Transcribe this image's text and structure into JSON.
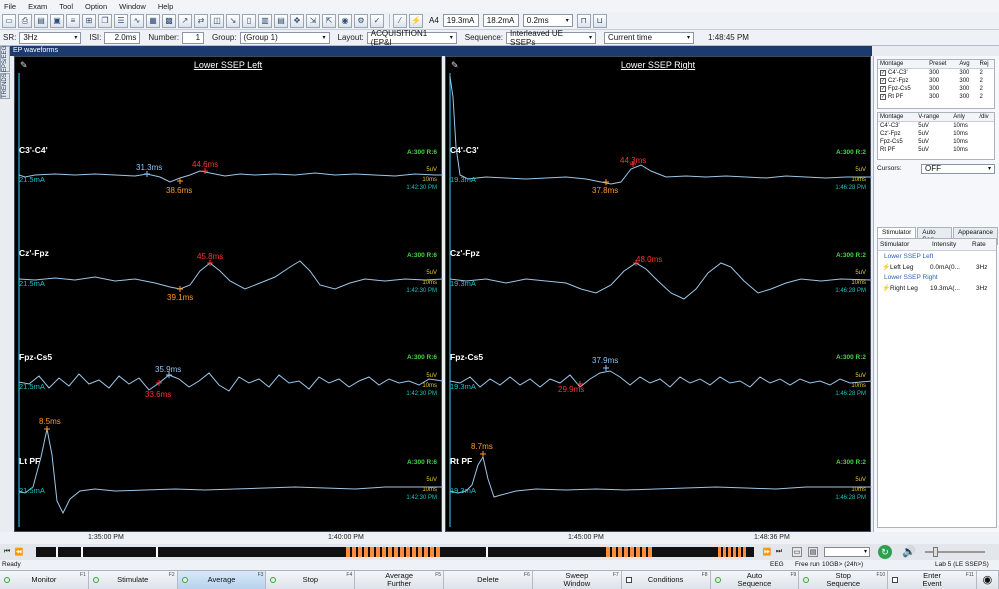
{
  "menu": [
    "File",
    "Exam",
    "Tool",
    "Option",
    "Window",
    "Help"
  ],
  "toolbar": {
    "paper_size": "A4",
    "intensity_1": "19.3mA",
    "intensity_2": "18.2mA",
    "duration": "0.2ms"
  },
  "settings": {
    "sr_label": "SR:",
    "sr_value": "3Hz",
    "isi_label": "ISI:",
    "isi_value": "2.0ms",
    "number_label": "Number:",
    "number_value": "1",
    "group_label": "Group:",
    "group_value": "(Group 1)",
    "layout_label": "Layout:",
    "layout_value": "ACQUISITION1 (EP&I",
    "sequence_label": "Sequence:",
    "sequence_value": "Interleaved UE SSEPs",
    "time_mode": "Current time",
    "clock": "1:48:45 PM"
  },
  "side_tabs": [
    "EPS/EEG",
    "TRENDS"
  ],
  "window_title": "EP waveforms",
  "left_panel": {
    "title": "Lower SSEP Left",
    "traces": [
      {
        "name": "C3'-C4'",
        "current": "21.5mA",
        "scale_a": "A:300 R:6",
        "uv": "5uV",
        "ms": "10ms",
        "time": "1:42:30 PM",
        "peaks": [
          {
            "label": "31.3ms",
            "color": "blue"
          },
          {
            "label": "44.6ms",
            "color": "red"
          },
          {
            "label": "38.6ms",
            "color": "orange"
          }
        ]
      },
      {
        "name": "Cz'-Fpz",
        "current": "21.5mA",
        "scale_a": "A:300 R:6",
        "uv": "5uV",
        "ms": "10ms",
        "time": "1:42:30 PM",
        "peaks": [
          {
            "label": "45.8ms",
            "color": "red"
          },
          {
            "label": "39.1ms",
            "color": "orange"
          }
        ]
      },
      {
        "name": "Fpz-Cs5",
        "current": "21.5mA",
        "scale_a": "A:300 R:6",
        "uv": "5uV",
        "ms": "10ms",
        "time": "1:42:30 PM",
        "peaks": [
          {
            "label": "35.9ms",
            "color": "blue"
          },
          {
            "label": "33.6ms",
            "color": "red"
          }
        ]
      },
      {
        "name": "Lt PF",
        "current": "21.5mA",
        "scale_a": "A:300 R:6",
        "uv": "5uV",
        "ms": "10ms",
        "time": "1:42:30 PM",
        "peaks": [
          {
            "label": "8.5ms",
            "color": "orange"
          }
        ]
      }
    ]
  },
  "right_panel": {
    "title": "Lower SSEP Right",
    "traces": [
      {
        "name": "C4'-C3'",
        "current": "19.3mA",
        "scale_a": "A:300 R:2",
        "uv": "5uV",
        "ms": "10ms",
        "time": "1:46:28 PM",
        "peaks": [
          {
            "label": "44.3ms",
            "color": "red"
          },
          {
            "label": "37.8ms",
            "color": "orange"
          }
        ]
      },
      {
        "name": "Cz'-Fpz",
        "current": "19.3mA",
        "scale_a": "A:300 R:2",
        "uv": "5uV",
        "ms": "10ms",
        "time": "1:46:28 PM",
        "peaks": [
          {
            "label": "48.0ms",
            "color": "red"
          }
        ]
      },
      {
        "name": "Fpz-Cs5",
        "current": "19.3mA",
        "scale_a": "A:300 R:2",
        "uv": "5uV",
        "ms": "10ms",
        "time": "1:46:28 PM",
        "peaks": [
          {
            "label": "37.9ms",
            "color": "blue"
          },
          {
            "label": "29.9ms",
            "color": "red"
          }
        ]
      },
      {
        "name": "Rt PF",
        "current": "19.3mA",
        "scale_a": "A:300 R:2",
        "uv": "5uV",
        "ms": "10ms",
        "time": "1:46:28 PM",
        "peaks": [
          {
            "label": "8.7ms",
            "color": "orange"
          }
        ]
      }
    ]
  },
  "montage_table": {
    "headers": [
      "Montage",
      "Preset",
      "Avg",
      "Rej"
    ],
    "rows": [
      [
        "C4'-C3'",
        "300",
        "300",
        "2"
      ],
      [
        "Cz'-Fpz",
        "300",
        "300",
        "2"
      ],
      [
        "Fpz-Cs5",
        "300",
        "300",
        "2"
      ],
      [
        "Rt PF",
        "300",
        "300",
        "2"
      ]
    ]
  },
  "vrange_table": {
    "headers": [
      "Montage",
      "V-range",
      "Anly",
      "/div"
    ],
    "rows": [
      [
        "C4'-C3'",
        "5uV",
        "10ms",
        ""
      ],
      [
        "Cz'-Fpz",
        "5uV",
        "10ms",
        ""
      ],
      [
        "Fpz-Cs5",
        "5uV",
        "10ms",
        ""
      ],
      [
        "Rt PF",
        "5uV",
        "10ms",
        ""
      ]
    ]
  },
  "cursors": {
    "label": "Cursors:",
    "value": "OFF"
  },
  "tabs": [
    "Stimulator",
    "Auto Seq",
    "Appearance"
  ],
  "stimulator": {
    "headers": [
      "Stimulator",
      "Intensity",
      "Rate"
    ],
    "groups": [
      {
        "name": "Lower SSEP Left",
        "row": {
          "site": "Left Leg",
          "intensity": "0.0mA(0...",
          "rate": "3Hz"
        }
      },
      {
        "name": "Lower SSEP Right",
        "row": {
          "site": "Right Leg",
          "intensity": "19.3mA(...",
          "rate": "3Hz"
        }
      }
    ]
  },
  "timeline": {
    "labels": [
      "1:35:00 PM",
      "1:40:00 PM",
      "1:45:00 PM"
    ],
    "current": "1:48:36 PM"
  },
  "status": {
    "left": "Ready",
    "mode": "EEG",
    "run": "Free run",
    "disk": "10GB> (24h>)",
    "exam": "Lab 5 (LE SSEPS)"
  },
  "function_keys": [
    {
      "label": "Monitor",
      "key": "F1"
    },
    {
      "label": "Stimulate",
      "key": "F2"
    },
    {
      "label": "Average",
      "key": "F3"
    },
    {
      "label": "Stop",
      "key": "F4"
    },
    {
      "label": "Average Further",
      "key": "F5"
    },
    {
      "label": "Delete",
      "key": "F6"
    },
    {
      "label": "Sweep Window",
      "key": "F7"
    },
    {
      "label": "Conditions",
      "key": "F8"
    },
    {
      "label": "Auto Sequence",
      "key": "F9"
    },
    {
      "label": "Stop Sequence",
      "key": "F10"
    },
    {
      "label": "Enter Event",
      "key": "F11"
    }
  ]
}
